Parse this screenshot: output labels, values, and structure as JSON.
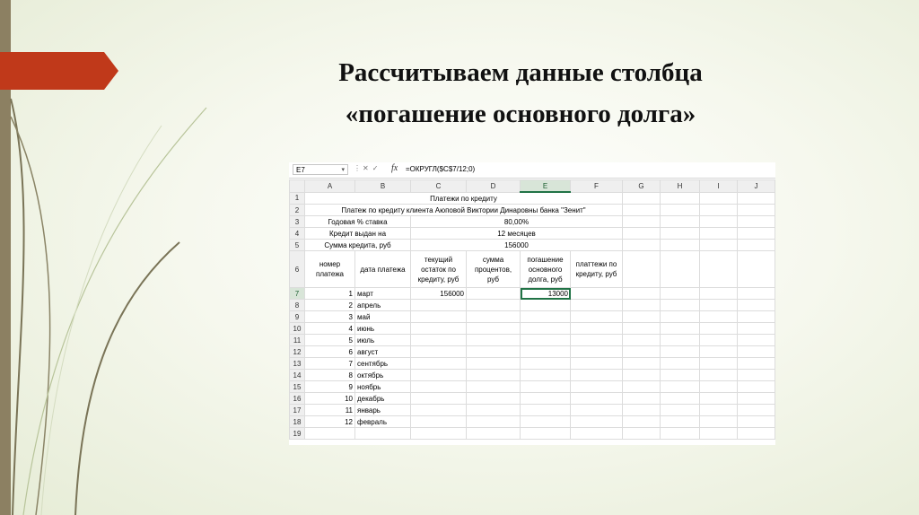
{
  "slide": {
    "title_line1": "Рассчитываем данные столбца",
    "title_line2": "«погашение основного долга»"
  },
  "colors": {
    "ribbon": "#c0391a",
    "stripe": "#8c8062",
    "swoosh": "#7a7457",
    "excel_green": "#217346"
  },
  "formula_bar": {
    "name_box": "E7",
    "formula": "=ОКРУГЛ($C$7/12;0)"
  },
  "sheet": {
    "columns": [
      "A",
      "B",
      "C",
      "D",
      "E",
      "F",
      "G",
      "H",
      "I",
      "J"
    ],
    "rows_header": [
      "1",
      "2",
      "3",
      "4",
      "5",
      "6",
      "7",
      "8",
      "9",
      "10",
      "11",
      "12",
      "13",
      "14",
      "15",
      "16",
      "17",
      "18",
      "19"
    ],
    "r1": "Платежи по кредиту",
    "r2": "Платеж по кредиту клиента Аюповой Виктории Динаровны банка \"Зенит\"",
    "r3_label": "Годовая % ставка",
    "r3_value": "80,00%",
    "r4_label": "Кредит выдан на",
    "r4_value": "12 месяцев",
    "r5_label": "Сумма кредита, руб",
    "r5_value": "156000",
    "headers": {
      "a": "номер платежа",
      "b": "дата платежа",
      "c": "текущий остаток по кредиту, руб",
      "d": "сумма процентов, руб",
      "e": "погашение основного долга, руб",
      "f": "платтежи по кредиту, руб"
    },
    "payments": [
      {
        "num": "1",
        "month": "март",
        "balance": "156000",
        "principal": "13000"
      },
      {
        "num": "2",
        "month": "апрель"
      },
      {
        "num": "3",
        "month": "май"
      },
      {
        "num": "4",
        "month": "июнь"
      },
      {
        "num": "5",
        "month": "июль"
      },
      {
        "num": "6",
        "month": "август"
      },
      {
        "num": "7",
        "month": "сентябрь"
      },
      {
        "num": "8",
        "month": "октябрь"
      },
      {
        "num": "9",
        "month": "ноябрь"
      },
      {
        "num": "10",
        "month": "декабрь"
      },
      {
        "num": "11",
        "month": "январь"
      },
      {
        "num": "12",
        "month": "февраль"
      }
    ]
  }
}
